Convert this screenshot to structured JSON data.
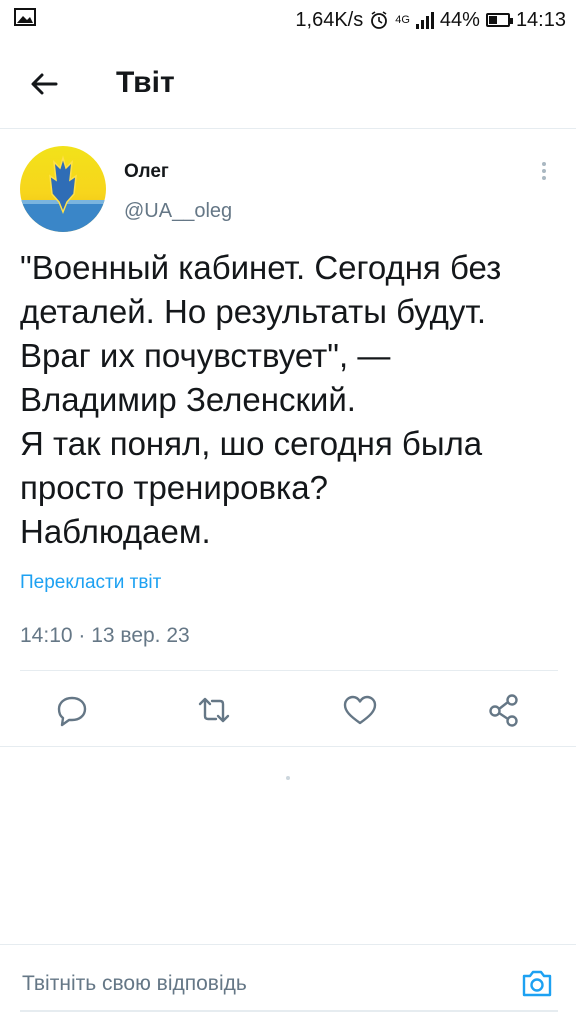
{
  "statusbar": {
    "speed": "1,64K/s",
    "network": "4G",
    "battery": "44%",
    "battery_level": 0.44,
    "time": "14:13"
  },
  "header": {
    "title": "Твіт"
  },
  "tweet": {
    "author_name": "Олег",
    "author_handle": "@UA__oleg",
    "text_lines": [
      "\"Военный кабинет. Сегодня без",
      "деталей. Но результаты будут.",
      "Враг их почувствует\", —",
      "Владимир Зеленский.",
      "Я так понял, шо сегодня была",
      "просто тренировка?",
      "Наблюдаем."
    ],
    "translate_label": "Перекласти твіт",
    "timestamp": "14:10 · 13 вер. 23"
  },
  "actions": [
    "reply-icon",
    "retweet-icon",
    "like-icon",
    "share-icon"
  ],
  "reply": {
    "placeholder": "Твітніть свою відповідь"
  },
  "colors": {
    "accent": "#1da1f2",
    "secondary_text": "#657786",
    "icon": "#657786"
  }
}
